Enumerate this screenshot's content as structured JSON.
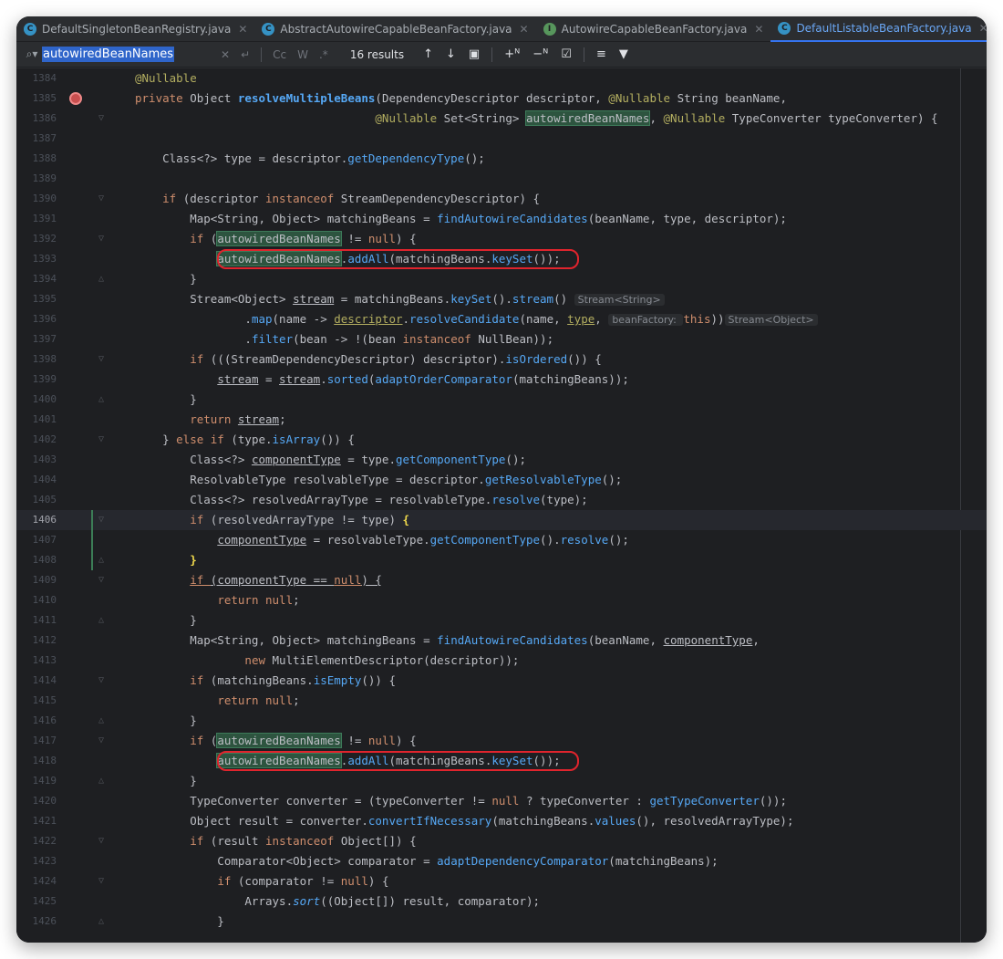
{
  "tabs": [
    {
      "label": "DefaultSingletonBeanRegistry.java",
      "icon": "class-icon",
      "color": "#3592c4",
      "glyph": "C",
      "active": false
    },
    {
      "label": "AbstractAutowireCapableBeanFactory.java",
      "icon": "abstract-class-icon",
      "color": "#3592c4",
      "glyph": "C",
      "active": false
    },
    {
      "label": "AutowireCapableBeanFactory.java",
      "icon": "interface-icon",
      "color": "#57965c",
      "glyph": "I",
      "active": false
    },
    {
      "label": "DefaultListableBeanFactory.java",
      "icon": "class-icon",
      "color": "#3592c4",
      "glyph": "C",
      "active": true
    }
  ],
  "search": {
    "query": "autowiredBeanNames",
    "results": "16 results",
    "options": [
      "Cc",
      "W",
      ".*"
    ]
  },
  "editor": {
    "current_line": "1406",
    "lines": [
      {
        "n": "1384"
      },
      {
        "n": "1385"
      },
      {
        "n": "1386"
      },
      {
        "n": "1387"
      },
      {
        "n": "1388"
      },
      {
        "n": "1389"
      },
      {
        "n": "1390"
      },
      {
        "n": "1391"
      },
      {
        "n": "1392"
      },
      {
        "n": "1393"
      },
      {
        "n": "1394"
      },
      {
        "n": "1395"
      },
      {
        "n": "1396"
      },
      {
        "n": "1397"
      },
      {
        "n": "1398"
      },
      {
        "n": "1399"
      },
      {
        "n": "1400"
      },
      {
        "n": "1401"
      },
      {
        "n": "1402"
      },
      {
        "n": "1403"
      },
      {
        "n": "1404"
      },
      {
        "n": "1405"
      },
      {
        "n": "1406"
      },
      {
        "n": "1407"
      },
      {
        "n": "1408"
      },
      {
        "n": "1409"
      },
      {
        "n": "1410"
      },
      {
        "n": "1411"
      },
      {
        "n": "1412"
      },
      {
        "n": "1413"
      },
      {
        "n": "1414"
      },
      {
        "n": "1415"
      },
      {
        "n": "1416"
      },
      {
        "n": "1417"
      },
      {
        "n": "1418"
      },
      {
        "n": "1419"
      },
      {
        "n": "1420"
      },
      {
        "n": "1421"
      },
      {
        "n": "1422"
      },
      {
        "n": "1423"
      },
      {
        "n": "1424"
      },
      {
        "n": "1425"
      },
      {
        "n": "1426"
      }
    ]
  },
  "code": {
    "l1384": [
      [
        "an",
        "@Nullable"
      ]
    ],
    "l1385": [
      [
        "kw",
        "private "
      ],
      [
        "",
        "Object "
      ],
      [
        "fnd bold",
        "resolveMultipleBeans"
      ],
      [
        "",
        "(DependencyDescriptor descriptor, "
      ],
      [
        "an",
        "@Nullable "
      ],
      [
        "",
        "String beanName,"
      ]
    ],
    "l1386": [
      [
        "",
        "                                   "
      ],
      [
        "an",
        "@Nullable "
      ],
      [
        "",
        "Set<String> "
      ],
      [
        "hl",
        "autowiredBeanNames"
      ],
      [
        "",
        ", "
      ],
      [
        "an",
        "@Nullable "
      ],
      [
        "",
        "TypeConverter typeConverter) {"
      ]
    ],
    "l1387": [],
    "l1388": [
      [
        "",
        "    Class<?> type = descriptor."
      ],
      [
        "fn",
        "getDependencyType"
      ],
      [
        "",
        "();"
      ]
    ],
    "l1389": [],
    "l1390": [
      [
        "",
        "    "
      ],
      [
        "kw",
        "if "
      ],
      [
        "",
        "(descriptor "
      ],
      [
        "kw",
        "instanceof "
      ],
      [
        "",
        "StreamDependencyDescriptor) {"
      ]
    ],
    "l1391": [
      [
        "",
        "        Map<String, Object> matchingBeans = "
      ],
      [
        "fn",
        "findAutowireCandidates"
      ],
      [
        "",
        "(beanName, type, descriptor);"
      ]
    ],
    "l1392": [
      [
        "",
        "        "
      ],
      [
        "kw",
        "if "
      ],
      [
        "",
        "("
      ],
      [
        "hl",
        "autowiredBeanNames"
      ],
      [
        "",
        " != "
      ],
      [
        "kw",
        "null"
      ],
      [
        "",
        ") {"
      ]
    ],
    "l1393": [
      [
        "",
        "            "
      ],
      [
        "hl",
        "autowiredBeanNames"
      ],
      [
        ".",
        ""
      ],
      [
        "fn",
        "addAll"
      ],
      [
        "",
        "(matchingBeans."
      ],
      [
        "fn",
        "keySet"
      ],
      [
        "",
        "());"
      ]
    ],
    "l1394": [
      [
        "",
        "        }"
      ]
    ],
    "l1395": [
      [
        "",
        "        Stream<Object> "
      ],
      [
        "var-u",
        "stream"
      ],
      [
        "",
        " = matchingBeans."
      ],
      [
        "fn",
        "keySet"
      ],
      [
        "",
        "()."
      ],
      [
        "fn",
        "stream"
      ],
      [
        "",
        "() "
      ],
      [
        "hint",
        "Stream<String>"
      ]
    ],
    "l1396": [
      [
        "",
        "                ."
      ],
      [
        "fn",
        "map"
      ],
      [
        "",
        "(name -> "
      ],
      [
        "var-u an",
        "descriptor"
      ],
      [
        "",
        "."
      ],
      [
        "fn",
        "resolveCandidate"
      ],
      [
        "",
        "(name, "
      ],
      [
        "var-u an",
        "type"
      ],
      [
        "",
        ", "
      ],
      [
        "hint",
        "beanFactory: "
      ],
      [
        "kw",
        "this"
      ],
      [
        "",
        "))"
      ],
      [
        "hint",
        "Stream<Object>"
      ]
    ],
    "l1397": [
      [
        "",
        "                ."
      ],
      [
        "fn",
        "filter"
      ],
      [
        "",
        "(bean -> !(bean "
      ],
      [
        "kw",
        "instanceof "
      ],
      [
        "",
        "NullBean));"
      ]
    ],
    "l1398": [
      [
        "",
        "        "
      ],
      [
        "kw",
        "if "
      ],
      [
        "",
        "(((StreamDependencyDescriptor) descriptor)."
      ],
      [
        "fn",
        "isOrdered"
      ],
      [
        "",
        "()) {"
      ]
    ],
    "l1399": [
      [
        "",
        "            "
      ],
      [
        "var-u",
        "stream"
      ],
      [
        "",
        " = "
      ],
      [
        "var-u",
        "stream"
      ],
      [
        "",
        "."
      ],
      [
        "fn",
        "sorted"
      ],
      [
        "",
        "("
      ],
      [
        "fn",
        "adaptOrderComparator"
      ],
      [
        "",
        "(matchingBeans));"
      ]
    ],
    "l1400": [
      [
        "",
        "        }"
      ]
    ],
    "l1401": [
      [
        "",
        "        "
      ],
      [
        "kw",
        "return "
      ],
      [
        "var-u",
        "stream"
      ],
      [
        "",
        ";"
      ]
    ],
    "l1402": [
      [
        "",
        "    } "
      ],
      [
        "kw",
        "else if "
      ],
      [
        "",
        "(type."
      ],
      [
        "fn",
        "isArray"
      ],
      [
        "",
        "()) {"
      ]
    ],
    "l1403": [
      [
        "",
        "        Class<?> "
      ],
      [
        "var-u",
        "componentType"
      ],
      [
        "",
        " = type."
      ],
      [
        "fn",
        "getComponentType"
      ],
      [
        "",
        "();"
      ]
    ],
    "l1404": [
      [
        "",
        "        ResolvableType resolvableType = descriptor."
      ],
      [
        "fn",
        "getResolvableType"
      ],
      [
        "",
        "();"
      ]
    ],
    "l1405": [
      [
        "",
        "        Class<?> resolvedArrayType = resolvableType."
      ],
      [
        "fn",
        "resolve"
      ],
      [
        "",
        "(type);"
      ]
    ],
    "l1406": [
      [
        "",
        "        "
      ],
      [
        "kw",
        "if "
      ],
      [
        "",
        "(resolvedArrayType != type) "
      ],
      [
        "bracket-y",
        "{"
      ]
    ],
    "l1407": [
      [
        "",
        "            "
      ],
      [
        "var-u",
        "componentType"
      ],
      [
        "",
        " = resolvableType."
      ],
      [
        "fn",
        "getComponentType"
      ],
      [
        "",
        "()."
      ],
      [
        "fn",
        "resolve"
      ],
      [
        "",
        "();"
      ]
    ],
    "l1408": [
      [
        "",
        "        "
      ],
      [
        "bracket-y",
        "}"
      ]
    ],
    "l1409": [
      [
        "",
        "        "
      ],
      [
        "kw var-u",
        "if "
      ],
      [
        "var-u",
        "(componentType == "
      ],
      [
        "kw var-u",
        "null"
      ],
      [
        "var-u",
        ") {"
      ]
    ],
    "l1410": [
      [
        "",
        "            "
      ],
      [
        "kw",
        "return null"
      ],
      [
        "",
        ";"
      ]
    ],
    "l1411": [
      [
        "",
        "        }"
      ]
    ],
    "l1412": [
      [
        "",
        "        Map<String, Object> matchingBeans = "
      ],
      [
        "fn",
        "findAutowireCandidates"
      ],
      [
        "",
        "(beanName, "
      ],
      [
        "var-u",
        "componentType"
      ],
      [
        "",
        ","
      ]
    ],
    "l1413": [
      [
        "",
        "                "
      ],
      [
        "kw",
        "new "
      ],
      [
        "",
        "MultiElementDescriptor(descriptor));"
      ]
    ],
    "l1414": [
      [
        "",
        "        "
      ],
      [
        "kw",
        "if "
      ],
      [
        "",
        "(matchingBeans."
      ],
      [
        "fn",
        "isEmpty"
      ],
      [
        "",
        "()) {"
      ]
    ],
    "l1415": [
      [
        "",
        "            "
      ],
      [
        "kw",
        "return null"
      ],
      [
        "",
        ";"
      ]
    ],
    "l1416": [
      [
        "",
        "        }"
      ]
    ],
    "l1417": [
      [
        "",
        "        "
      ],
      [
        "kw",
        "if "
      ],
      [
        "",
        "("
      ],
      [
        "hl",
        "autowiredBeanNames"
      ],
      [
        "",
        " != "
      ],
      [
        "kw",
        "null"
      ],
      [
        "",
        ") {"
      ]
    ],
    "l1418": [
      [
        "",
        "            "
      ],
      [
        "hl",
        "autowiredBeanNames"
      ],
      [
        "",
        "."
      ],
      [
        "fn",
        "addAll"
      ],
      [
        "",
        "(matchingBeans."
      ],
      [
        "fn",
        "keySet"
      ],
      [
        "",
        "());"
      ]
    ],
    "l1419": [
      [
        "",
        "        }"
      ]
    ],
    "l1420": [
      [
        "",
        "        TypeConverter converter = (typeConverter != "
      ],
      [
        "kw",
        "null "
      ],
      [
        "",
        "? typeConverter : "
      ],
      [
        "fn",
        "getTypeConverter"
      ],
      [
        "",
        "());"
      ]
    ],
    "l1421": [
      [
        "",
        "        Object result = converter."
      ],
      [
        "fn",
        "convertIfNecessary"
      ],
      [
        "",
        "(matchingBeans."
      ],
      [
        "fn",
        "values"
      ],
      [
        "",
        "(), resolvedArrayType);"
      ]
    ],
    "l1422": [
      [
        "",
        "        "
      ],
      [
        "kw",
        "if "
      ],
      [
        "",
        "(result "
      ],
      [
        "kw",
        "instanceof "
      ],
      [
        "",
        "Object[]) {"
      ]
    ],
    "l1423": [
      [
        "",
        "            Comparator<Object> comparator = "
      ],
      [
        "fn",
        "adaptDependencyComparator"
      ],
      [
        "",
        "(matchingBeans);"
      ]
    ],
    "l1424": [
      [
        "",
        "            "
      ],
      [
        "kw",
        "if "
      ],
      [
        "",
        "(comparator != "
      ],
      [
        "kw",
        "null"
      ],
      [
        "",
        ") {"
      ]
    ],
    "l1425": [
      [
        "",
        "                Arrays."
      ],
      [
        "fn static",
        "sort"
      ],
      [
        "",
        "((Object[]) result, comparator);"
      ]
    ],
    "l1426": [
      [
        "",
        "            }"
      ]
    ]
  },
  "colors": {
    "keyword": "#cf8e6d",
    "annotation": "#b3ae60",
    "method": "#56a8f5",
    "search_highlight": "#2d543f",
    "red_box": "#e0242d"
  }
}
